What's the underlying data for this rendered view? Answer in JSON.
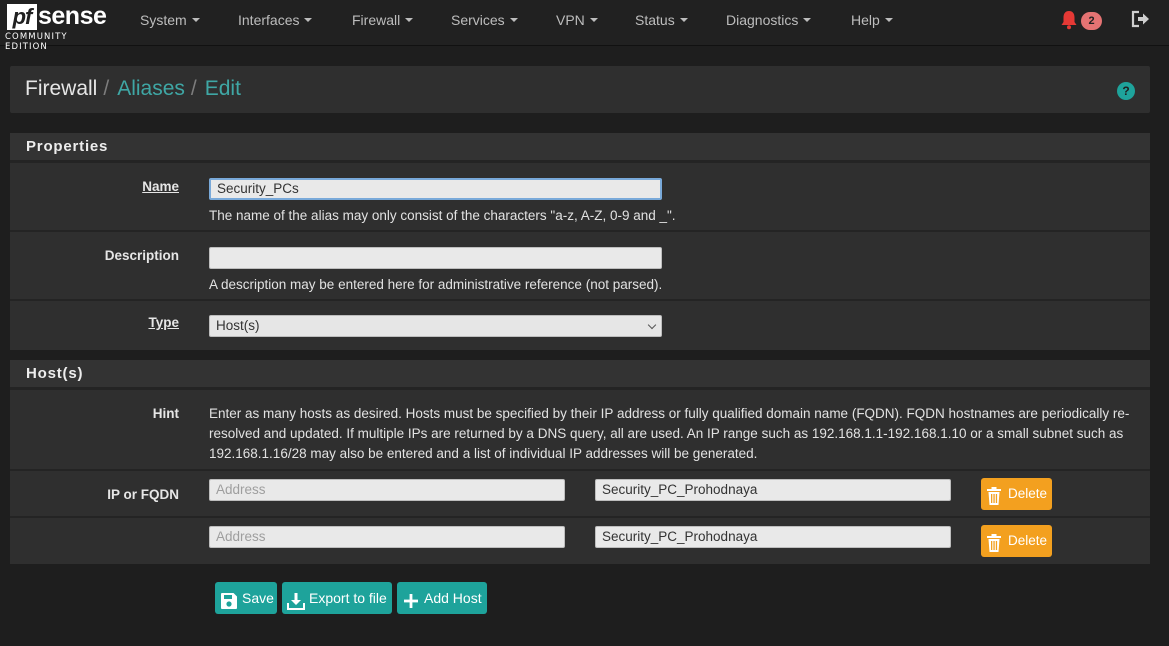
{
  "brand": {
    "logo_pf": "pf",
    "logo_sense": "sense",
    "edition": "COMMUNITY EDITION"
  },
  "nav": {
    "items": [
      "System",
      "Interfaces",
      "Firewall",
      "Services",
      "VPN",
      "Status",
      "Diagnostics",
      "Help"
    ],
    "notification_count": "2",
    "icons": {
      "notifications": "bell-icon",
      "logout": "sign-out-icon"
    }
  },
  "breadcrumb": {
    "items": [
      "Firewall",
      "Aliases",
      "Edit"
    ],
    "separator": "/"
  },
  "properties_panel": {
    "title": "Properties",
    "name": {
      "label": "Name",
      "value": "Security_PCs",
      "help": "The name of the alias may only consist of the characters \"a-z, A-Z, 0-9 and _\"."
    },
    "description": {
      "label": "Description",
      "value": "",
      "help": "A description may be entered here for administrative reference (not parsed)."
    },
    "type": {
      "label": "Type",
      "selected": "Host(s)"
    }
  },
  "hosts_panel": {
    "title": "Host(s)",
    "hint_label": "Hint",
    "hint_text": "Enter as many hosts as desired. Hosts must be specified by their IP address or fully qualified domain name (FQDN). FQDN hostnames are periodically re-resolved and updated. If multiple IPs are returned by a DNS query, all are used. An IP range such as 192.168.1.1-192.168.1.10 or a small subnet such as 192.168.1.16/28 may also be entered and a list of individual IP addresses will be generated.",
    "ip_label": "IP or FQDN",
    "rows": [
      {
        "address_value": "",
        "address_placeholder": "Address",
        "description": "Security_PC_Prohodnaya",
        "delete_label": "Delete"
      },
      {
        "address_value": "",
        "address_placeholder": "Address",
        "description": "Security_PC_Prohodnaya",
        "delete_label": "Delete"
      }
    ]
  },
  "actions": {
    "save": "Save",
    "export": "Export to file",
    "add_host": "Add Host"
  },
  "colors": {
    "accent": "#1ea39b",
    "link": "#3fa7a5",
    "warning": "#f3a01f",
    "badge": "#e57373"
  }
}
